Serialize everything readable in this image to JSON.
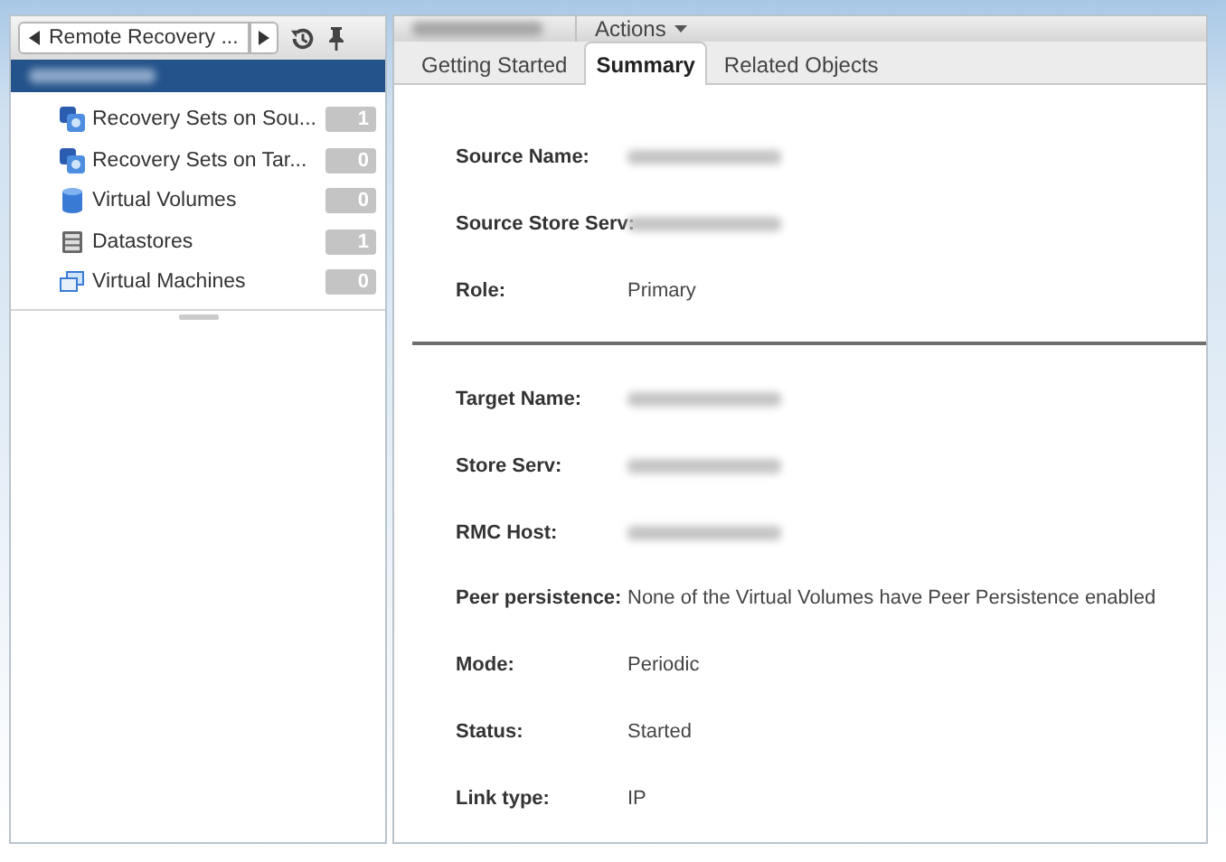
{
  "navigator": {
    "title": "Remote Recovery ...",
    "selected_object": {
      "kind": "redacted"
    },
    "items": [
      {
        "label": "Recovery Sets on Sou...",
        "count": "1",
        "kind": "recovery-set"
      },
      {
        "label": "Recovery Sets on Tar...",
        "count": "0",
        "kind": "recovery-set"
      },
      {
        "label": "Virtual Volumes",
        "count": "0",
        "kind": "volume"
      },
      {
        "label": "Datastores",
        "count": "1",
        "kind": "datastore"
      },
      {
        "label": "Virtual Machines",
        "count": "0",
        "kind": "vm"
      }
    ]
  },
  "object_header": {
    "name": {
      "kind": "redacted"
    },
    "actions": "Actions"
  },
  "tabs": [
    {
      "label": "Getting Started",
      "selected": false
    },
    {
      "label": "Summary",
      "selected": true
    },
    {
      "label": "Related Objects",
      "selected": false
    }
  ],
  "sections": [
    {
      "fields": [
        {
          "label": "Source Name:",
          "value": {
            "kind": "redacted"
          }
        },
        {
          "label": "Source  Store Serv:",
          "value": {
            "kind": "redacted"
          }
        },
        {
          "label": "Role:",
          "value": {
            "kind": "text",
            "text": "Primary"
          }
        }
      ]
    },
    {
      "fields": [
        {
          "label": "Target Name:",
          "value": {
            "kind": "redacted"
          }
        },
        {
          "label": "Store Serv:",
          "value": {
            "kind": "redacted"
          }
        },
        {
          "label": "RMC Host:",
          "value": {
            "kind": "redacted"
          }
        },
        {
          "label": "Peer persistence:",
          "value": {
            "kind": "text",
            "text": "None of the Virtual Volumes have Peer Persistence enabled"
          }
        },
        {
          "label": "Mode:",
          "value": {
            "kind": "text",
            "text": "Periodic"
          }
        },
        {
          "label": "Status:",
          "value": {
            "kind": "text",
            "text": "Started"
          }
        },
        {
          "label": "Link type:",
          "value": {
            "kind": "text",
            "text": "IP"
          }
        }
      ]
    }
  ]
}
